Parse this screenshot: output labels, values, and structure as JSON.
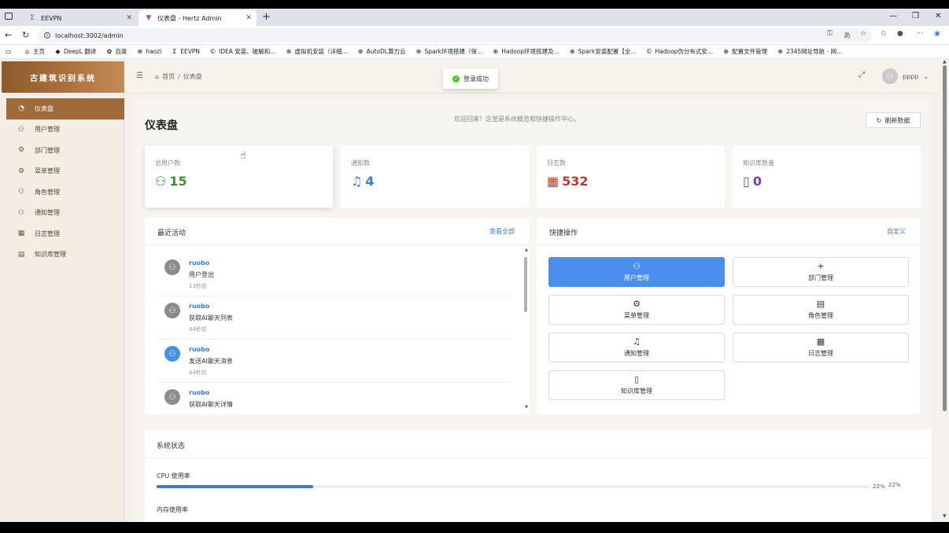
{
  "browser": {
    "tabs": [
      {
        "title": "EEVPN",
        "active": false,
        "favicon": "sigma-icon"
      },
      {
        "title": "仪表盘 - Hertz Admin",
        "active": true,
        "favicon": "vite-icon"
      }
    ],
    "url": "localhost:3002/admin",
    "bookmarks": [
      {
        "label": "主页",
        "icon": "home-icon"
      },
      {
        "label": "DeepL 翻译",
        "icon": "deepl-icon"
      },
      {
        "label": "百度",
        "icon": "baidu-icon"
      },
      {
        "label": "haozi",
        "icon": "globe-icon"
      },
      {
        "label": "EEVPN",
        "icon": "sigma-icon"
      },
      {
        "label": "IDEA 安装、破解和...",
        "icon": "csdn-icon"
      },
      {
        "label": "虚拟机安装（详细...",
        "icon": "globe-icon"
      },
      {
        "label": "AutoDL算力云",
        "icon": "globe-icon"
      },
      {
        "label": "Spark环境搭建（保...",
        "icon": "globe-icon"
      },
      {
        "label": "Hadoop环境搭建及...",
        "icon": "globe-icon"
      },
      {
        "label": "Spark安装配置【全...",
        "icon": "globe-icon"
      },
      {
        "label": "Hadoop伪分布式安...",
        "icon": "csdn-icon"
      },
      {
        "label": "配置文件管理",
        "icon": "globe-icon"
      },
      {
        "label": "2345网址导航 - 网...",
        "icon": "globe-icon"
      }
    ]
  },
  "sidebar": {
    "logo": "古建筑识别系统",
    "items": [
      {
        "label": "仪表盘",
        "icon": "dashboard-icon",
        "active": true
      },
      {
        "label": "用户管理",
        "icon": "user-icon",
        "active": false
      },
      {
        "label": "部门管理",
        "icon": "gear-icon",
        "active": false
      },
      {
        "label": "菜单管理",
        "icon": "gear-icon",
        "active": false
      },
      {
        "label": "角色管理",
        "icon": "user-icon",
        "active": false
      },
      {
        "label": "通知管理",
        "icon": "user-icon",
        "active": false
      },
      {
        "label": "日志管理",
        "icon": "log-icon",
        "active": false
      },
      {
        "label": "知识库管理",
        "icon": "list-icon",
        "active": false
      }
    ]
  },
  "header": {
    "breadcrumb_home": "首页",
    "breadcrumb_sep": "/",
    "breadcrumb_current": "仪表盘",
    "username": "pppp"
  },
  "toast": {
    "message": "登录成功"
  },
  "main": {
    "title": "仪表盘",
    "welcome": "欢迎回来！这里是系统概览和快捷操作中心。",
    "refresh_label": "刷新数据",
    "stats": [
      {
        "label": "总用户数",
        "value": "15",
        "color": "#3f8f3a",
        "icon": "user-icon"
      },
      {
        "label": "通知数",
        "value": "4",
        "color": "#3a7bd5",
        "icon": "bell-icon"
      },
      {
        "label": "日志数",
        "value": "532",
        "color": "#c0392b",
        "icon": "log-icon"
      },
      {
        "label": "知识库数量",
        "value": "0",
        "color": "#7b3fa0",
        "icon": "book-icon"
      }
    ],
    "recent": {
      "title": "最近活动",
      "link": "查看全部",
      "items": [
        {
          "user": "ruobo",
          "action": "用户登出",
          "time": "13秒前",
          "avatar": "gray"
        },
        {
          "user": "ruobo",
          "action": "获取AI聊天列表",
          "time": "44秒前",
          "avatar": "gray"
        },
        {
          "user": "ruobo",
          "action": "发送AI聊天消息",
          "time": "44秒前",
          "avatar": "blue"
        },
        {
          "user": "ruobo",
          "action": "获取AI聊天详情",
          "time": "",
          "avatar": "gray"
        }
      ]
    },
    "quick": {
      "title": "快捷操作",
      "link": "自定义",
      "actions": [
        {
          "label": "用户管理",
          "icon": "user-icon",
          "glyph": "⚇",
          "primary": true
        },
        {
          "label": "部门管理",
          "icon": "plus-icon",
          "glyph": "+",
          "primary": false
        },
        {
          "label": "菜单管理",
          "icon": "gear-icon",
          "glyph": "⚙",
          "primary": false
        },
        {
          "label": "角色管理",
          "icon": "list-icon",
          "glyph": "▤",
          "primary": false
        },
        {
          "label": "通知管理",
          "icon": "bell-icon",
          "glyph": "♫",
          "primary": false
        },
        {
          "label": "日志管理",
          "icon": "log-icon",
          "glyph": "▦",
          "primary": false
        },
        {
          "label": "知识库管理",
          "icon": "book-icon",
          "glyph": "▯",
          "primary": false
        }
      ]
    },
    "system": {
      "title": "系统状态",
      "cpu_label": "CPU 使用率",
      "cpu_value": 22,
      "cpu_text": "22%",
      "cpu_text_outer": "22%",
      "mem_label": "内存使用率"
    }
  }
}
